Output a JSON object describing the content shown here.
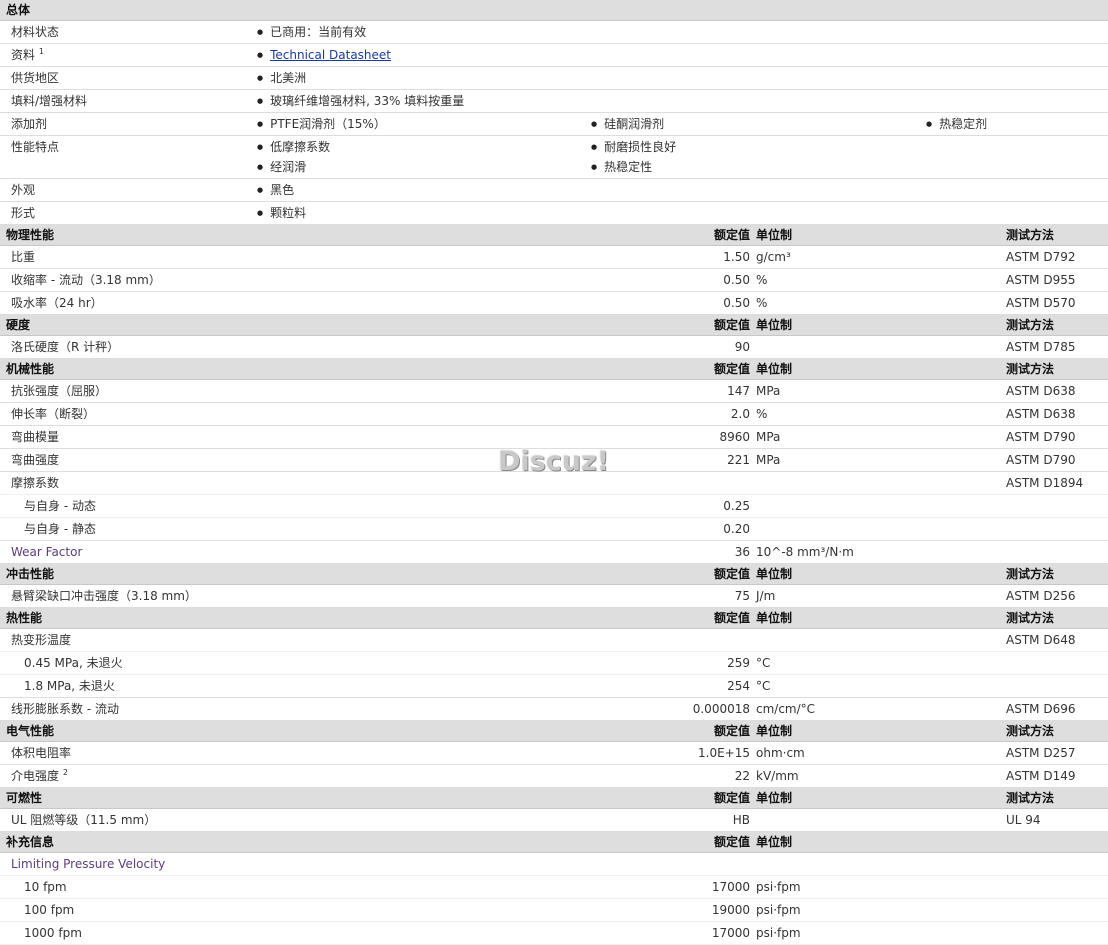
{
  "general": {
    "title": "总体",
    "rows": [
      {
        "label": "材料状态",
        "items": [
          "已商用：当前有效"
        ]
      },
      {
        "label": "资料",
        "sup": "1",
        "link": "Technical Datasheet"
      },
      {
        "label": "供货地区",
        "items": [
          "北美洲"
        ]
      },
      {
        "label": "填料/增强材料",
        "items": [
          "玻璃纤维增强材料, 33% 填料按重量"
        ]
      },
      {
        "label": "添加剂",
        "items": [
          "PTFE润滑剂（15%）",
          "硅酮润滑剂",
          "热稳定剂"
        ]
      },
      {
        "label": "性能特点",
        "items": [
          "低摩擦系数",
          "耐磨损性良好",
          "经润滑",
          "热稳定性"
        ]
      },
      {
        "label": "外观",
        "items": [
          "黑色"
        ]
      },
      {
        "label": "形式",
        "items": [
          "颗粒料"
        ]
      }
    ]
  },
  "headers": {
    "value": "额定值",
    "unit": "单位制",
    "test": "测试方法"
  },
  "sections": [
    {
      "title": "物理性能",
      "rows": [
        {
          "label": "比重",
          "value": "1.50",
          "unit": "g/cm³",
          "test": "ASTM D792"
        },
        {
          "label": "收缩率  - 流动（3.18 mm）",
          "value": "0.50",
          "unit": "%",
          "test": "ASTM D955"
        },
        {
          "label": "吸水率（24 hr）",
          "value": "0.50",
          "unit": "%",
          "test": "ASTM D570"
        }
      ]
    },
    {
      "title": "硬度",
      "rows": [
        {
          "label": "洛氏硬度（R 计秤）",
          "value": "90",
          "unit": "",
          "test": "ASTM D785"
        }
      ]
    },
    {
      "title": "机械性能",
      "rows": [
        {
          "label": "抗张强度（屈服）",
          "value": "147",
          "unit": "MPa",
          "test": "ASTM D638"
        },
        {
          "label": "伸长率（断裂）",
          "value": "2.0",
          "unit": "%",
          "test": "ASTM D638"
        },
        {
          "label": "弯曲模量",
          "value": "8960",
          "unit": "MPa",
          "test": "ASTM D790"
        },
        {
          "label": "弯曲强度",
          "value": "221",
          "unit": "MPa",
          "test": "ASTM D790"
        },
        {
          "label": "摩擦系数",
          "value": "",
          "unit": "",
          "test": "ASTM D1894"
        },
        {
          "label": "与自身  - 动态",
          "value": "0.25",
          "unit": "",
          "test": ""
        },
        {
          "label": "与自身  - 静态",
          "value": "0.20",
          "unit": "",
          "test": ""
        },
        {
          "label": "Wear Factor",
          "value": "36",
          "unit": "10^-8 mm³/N·m",
          "test": ""
        }
      ]
    },
    {
      "title": "冲击性能",
      "rows": [
        {
          "label": "悬臂梁缺口冲击强度（3.18 mm）",
          "value": "75",
          "unit": "J/m",
          "test": "ASTM D256"
        }
      ]
    },
    {
      "title": "热性能",
      "rows": [
        {
          "label": "热变形温度",
          "value": "",
          "unit": "",
          "test": "ASTM D648"
        },
        {
          "label": "0.45 MPa, 未退火",
          "value": "259",
          "unit": "°C",
          "test": ""
        },
        {
          "label": "1.8 MPa, 未退火",
          "value": "254",
          "unit": "°C",
          "test": ""
        },
        {
          "label": "线形膨胀系数  - 流动",
          "value": "0.000018",
          "unit": "cm/cm/°C",
          "test": "ASTM D696"
        }
      ]
    },
    {
      "title": "电气性能",
      "rows": [
        {
          "label": "体积电阻率",
          "value": "1.0E+15",
          "unit": "ohm·cm",
          "test": "ASTM D257"
        },
        {
          "label": "介电强度",
          "sup": "2",
          "value": "22",
          "unit": "kV/mm",
          "test": "ASTM D149"
        }
      ]
    },
    {
      "title": "可燃性",
      "rows": [
        {
          "label": "UL 阻燃等级（11.5 mm）",
          "value": "HB",
          "unit": "",
          "test": "UL 94"
        }
      ]
    },
    {
      "title": "补充信息",
      "rows": [
        {
          "label": "Limiting Pressure Velocity",
          "value": "",
          "unit": "",
          "test": ""
        },
        {
          "label": "10 fpm",
          "value": "17000",
          "unit": "psi·fpm",
          "test": ""
        },
        {
          "label": "100 fpm",
          "value": "19000",
          "unit": "psi·fpm",
          "test": ""
        },
        {
          "label": "1000 fpm",
          "value": "17000",
          "unit": "psi·fpm",
          "test": ""
        }
      ]
    }
  ],
  "watermark": "Discuz!"
}
